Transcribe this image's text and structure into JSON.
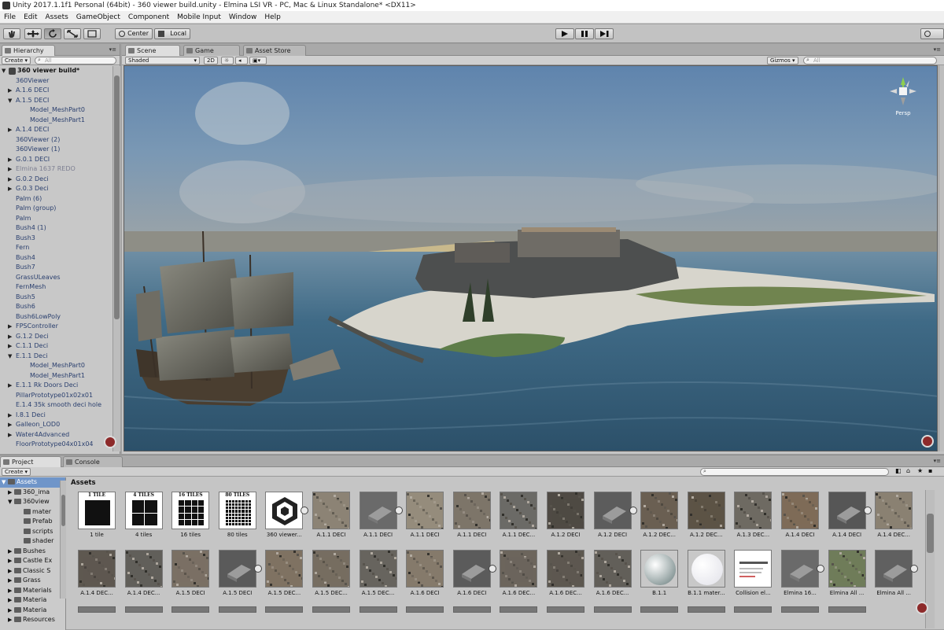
{
  "window": {
    "title": "Unity 2017.1.1f1 Personal (64bit) - 360 viewer build.unity - Elmina LSI VR - PC, Mac & Linux Standalone* <DX11>"
  },
  "menu": [
    "File",
    "Edit",
    "Assets",
    "GameObject",
    "Component",
    "Mobile Input",
    "Window",
    "Help"
  ],
  "toolbar": {
    "center_label": "Center",
    "local_label": "Local"
  },
  "hierarchy": {
    "tab_label": "Hierarchy",
    "create_label": "Create",
    "search_placeholder": "All",
    "items": [
      {
        "label": "360 viewer build*",
        "depth": 0,
        "twisty": "▼",
        "style": "root"
      },
      {
        "label": "360Viewer",
        "depth": 1,
        "twisty": "",
        "style": ""
      },
      {
        "label": "A.1.6 DECI",
        "depth": 1,
        "twisty": "▶",
        "style": ""
      },
      {
        "label": "A.1.5 DECI",
        "depth": 1,
        "twisty": "▼",
        "style": ""
      },
      {
        "label": "Model_MeshPart0",
        "depth": 2,
        "twisty": "",
        "style": ""
      },
      {
        "label": "Model_MeshPart1",
        "depth": 2,
        "twisty": "",
        "style": ""
      },
      {
        "label": "A.1.4 DECI",
        "depth": 1,
        "twisty": "▶",
        "style": ""
      },
      {
        "label": "360Viewer (2)",
        "depth": 1,
        "twisty": "",
        "style": ""
      },
      {
        "label": "360Viewer (1)",
        "depth": 1,
        "twisty": "",
        "style": ""
      },
      {
        "label": "G.0.1 DECI",
        "depth": 1,
        "twisty": "▶",
        "style": ""
      },
      {
        "label": "Elmina 1637 REDO",
        "depth": 1,
        "twisty": "▶",
        "style": "dim"
      },
      {
        "label": "G.0.2 Deci",
        "depth": 1,
        "twisty": "▶",
        "style": ""
      },
      {
        "label": "G.0.3 Deci",
        "depth": 1,
        "twisty": "▶",
        "style": ""
      },
      {
        "label": "Palm (6)",
        "depth": 1,
        "twisty": "",
        "style": ""
      },
      {
        "label": "Palm (group)",
        "depth": 1,
        "twisty": "",
        "style": ""
      },
      {
        "label": "Palm",
        "depth": 1,
        "twisty": "",
        "style": ""
      },
      {
        "label": "Bush4 (1)",
        "depth": 1,
        "twisty": "",
        "style": ""
      },
      {
        "label": "Bush3",
        "depth": 1,
        "twisty": "",
        "style": ""
      },
      {
        "label": "Fern",
        "depth": 1,
        "twisty": "",
        "style": ""
      },
      {
        "label": "Bush4",
        "depth": 1,
        "twisty": "",
        "style": ""
      },
      {
        "label": "Bush7",
        "depth": 1,
        "twisty": "",
        "style": ""
      },
      {
        "label": "GrassULeaves",
        "depth": 1,
        "twisty": "",
        "style": ""
      },
      {
        "label": "FernMesh",
        "depth": 1,
        "twisty": "",
        "style": ""
      },
      {
        "label": "Bush5",
        "depth": 1,
        "twisty": "",
        "style": ""
      },
      {
        "label": "Bush6",
        "depth": 1,
        "twisty": "",
        "style": ""
      },
      {
        "label": "Bush6LowPoly",
        "depth": 1,
        "twisty": "",
        "style": ""
      },
      {
        "label": "FPSController",
        "depth": 1,
        "twisty": "▶",
        "style": ""
      },
      {
        "label": "G.1.2 Deci",
        "depth": 1,
        "twisty": "▶",
        "style": ""
      },
      {
        "label": "C.1.1 Deci",
        "depth": 1,
        "twisty": "▶",
        "style": ""
      },
      {
        "label": "E.1.1 Deci",
        "depth": 1,
        "twisty": "▼",
        "style": ""
      },
      {
        "label": "Model_MeshPart0",
        "depth": 2,
        "twisty": "",
        "style": ""
      },
      {
        "label": "Model_MeshPart1",
        "depth": 2,
        "twisty": "",
        "style": ""
      },
      {
        "label": "E.1.1 Rk Doors Deci",
        "depth": 1,
        "twisty": "▶",
        "style": ""
      },
      {
        "label": "PillarPrototype01x02x01",
        "depth": 1,
        "twisty": "",
        "style": ""
      },
      {
        "label": "E.1.4 35k smooth deci hole",
        "depth": 1,
        "twisty": "",
        "style": ""
      },
      {
        "label": "I.8.1 Deci",
        "depth": 1,
        "twisty": "▶",
        "style": ""
      },
      {
        "label": "Galleon_LOD0",
        "depth": 1,
        "twisty": "▶",
        "style": ""
      },
      {
        "label": "Water4Advanced",
        "depth": 1,
        "twisty": "▶",
        "style": ""
      },
      {
        "label": "FloorPrototype04x01x04",
        "depth": 1,
        "twisty": "",
        "style": ""
      }
    ]
  },
  "scene": {
    "tabs": [
      "Scene",
      "Game",
      "Asset Store"
    ],
    "shading_mode": "Shaded",
    "mode_2d_label": "2D",
    "gizmos_label": "Gizmos",
    "search_placeholder": "All",
    "gizmo_label": "Persp"
  },
  "project": {
    "tabs": [
      "Project",
      "Console"
    ],
    "create_label": "Create",
    "tree": [
      {
        "label": "Assets",
        "depth": 0,
        "selected": true
      },
      {
        "label": "360_ima",
        "depth": 1,
        "selected": false
      },
      {
        "label": "360view",
        "depth": 1,
        "selected": false
      },
      {
        "label": "mater",
        "depth": 2,
        "selected": false
      },
      {
        "label": "Prefab",
        "depth": 2,
        "selected": false
      },
      {
        "label": "scripts",
        "depth": 2,
        "selected": false
      },
      {
        "label": "shader",
        "depth": 2,
        "selected": false
      },
      {
        "label": "Bushes",
        "depth": 1,
        "selected": false
      },
      {
        "label": "Castle Ex",
        "depth": 1,
        "selected": false
      },
      {
        "label": "Classic S",
        "depth": 1,
        "selected": false
      },
      {
        "label": "Grass",
        "depth": 1,
        "selected": false
      },
      {
        "label": "Materials",
        "depth": 1,
        "selected": false
      },
      {
        "label": "Materia",
        "depth": 1,
        "selected": false
      },
      {
        "label": "Materia",
        "depth": 1,
        "selected": false
      },
      {
        "label": "Resources",
        "depth": 1,
        "selected": false
      }
    ],
    "breadcrumb": "Assets",
    "row1": [
      {
        "label": "1 tile",
        "kind": "tile",
        "tile_text": "1 TILE",
        "grid": 1
      },
      {
        "label": "4 tiles",
        "kind": "tile",
        "tile_text": "4 TILES",
        "grid": 2
      },
      {
        "label": "16 tiles",
        "kind": "tile",
        "tile_text": "16 TILES",
        "grid": 4
      },
      {
        "label": "80 tiles",
        "kind": "tile",
        "tile_text": "80 TILES",
        "grid": 8
      },
      {
        "label": "360 viewer...",
        "kind": "unity"
      },
      {
        "label": "A.1.1 DECI",
        "kind": "tex",
        "color": "#8c8375"
      },
      {
        "label": "A.1.1 DECI",
        "kind": "mesh",
        "color": "#6a6a6a"
      },
      {
        "label": "A.1.1 DECI",
        "kind": "tex",
        "color": "#958c7c"
      },
      {
        "label": "A.1.1 DECI",
        "kind": "tex",
        "color": "#7d7569"
      },
      {
        "label": "A.1.1 DEC...",
        "kind": "noise",
        "color": "#6b6a66"
      },
      {
        "label": "A.1.2 DECI",
        "kind": "tex",
        "color": "#4f4a44"
      },
      {
        "label": "A.1.2 DECI",
        "kind": "mesh",
        "color": "#5c5c5c"
      },
      {
        "label": "A.1.2 DEC...",
        "kind": "tex",
        "color": "#6a5f52"
      },
      {
        "label": "A.1.2 DEC...",
        "kind": "tex",
        "color": "#5c5346"
      },
      {
        "label": "A.1.3 DEC...",
        "kind": "noise",
        "color": "#6e6a62"
      },
      {
        "label": "A.1.4 DECI",
        "kind": "tex",
        "color": "#7e6b58"
      },
      {
        "label": "A.1.4 DECI",
        "kind": "mesh",
        "color": "#565656"
      },
      {
        "label": "A.1.4 DEC...",
        "kind": "tex",
        "color": "#8a8172"
      }
    ],
    "row2": [
      {
        "label": "A.1.4 DEC...",
        "kind": "tex",
        "color": "#5e5850"
      },
      {
        "label": "A.1.4 DEC...",
        "kind": "noise",
        "color": "#615f5a"
      },
      {
        "label": "A.1.5 DECI",
        "kind": "tex",
        "color": "#7a7064"
      },
      {
        "label": "A.1.5 DECI",
        "kind": "mesh",
        "color": "#5a5a5a"
      },
      {
        "label": "A.1.5 DEC...",
        "kind": "tex",
        "color": "#7f7262"
      },
      {
        "label": "A.1.5 DEC...",
        "kind": "tex",
        "color": "#766d61"
      },
      {
        "label": "A.1.5 DEC...",
        "kind": "noise",
        "color": "#67645e"
      },
      {
        "label": "A.1.6 DECI",
        "kind": "tex",
        "color": "#857a6b"
      },
      {
        "label": "A.1.6 DECI",
        "kind": "mesh",
        "color": "#5b5b5b"
      },
      {
        "label": "A.1.6 DEC...",
        "kind": "tex",
        "color": "#6c655c"
      },
      {
        "label": "A.1.6 DEC...",
        "kind": "tex",
        "color": "#5d5850"
      },
      {
        "label": "A.1.6 DEC...",
        "kind": "noise",
        "color": "#625f59"
      },
      {
        "label": "B.1.1",
        "kind": "sphere",
        "color": "#8a9a9a"
      },
      {
        "label": "B.1.1 mater...",
        "kind": "sphere",
        "color": "#e8e8ee"
      },
      {
        "label": "Collision el...",
        "kind": "doc",
        "color": "#ffffff"
      },
      {
        "label": "Elmina 16...",
        "kind": "mesh",
        "color": "#6a6a6a"
      },
      {
        "label": "Elmina All ...",
        "kind": "tex",
        "color": "#6f7c5a"
      },
      {
        "label": "Elmina All ...",
        "kind": "mesh",
        "color": "#606060"
      }
    ]
  }
}
